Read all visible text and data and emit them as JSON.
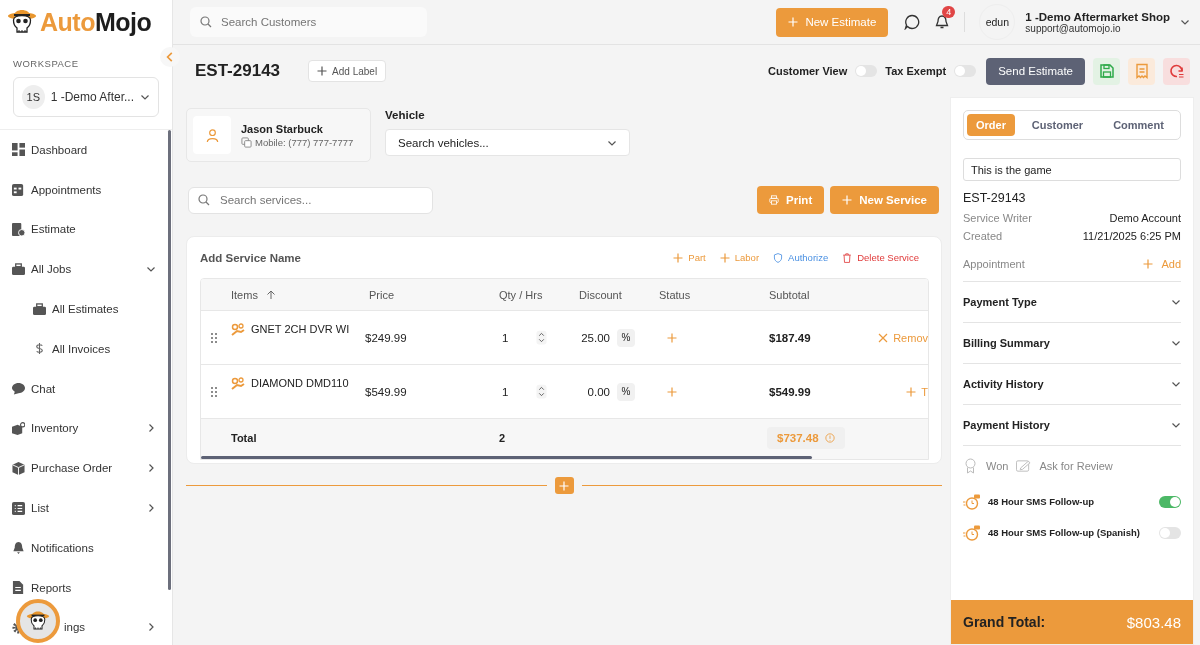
{
  "logo": {
    "lead": "Auto",
    "tail": "Mojo"
  },
  "workspace": {
    "label": "WORKSPACE",
    "initials": "1S",
    "name": "1 -Demo After..."
  },
  "sidebar": {
    "items": [
      {
        "label": "Dashboard",
        "kind": "link"
      },
      {
        "label": "Appointments",
        "kind": "link"
      },
      {
        "label": "Estimate",
        "kind": "link"
      },
      {
        "label": "All Jobs",
        "kind": "group",
        "expanded": true,
        "children": [
          {
            "label": "All Estimates"
          },
          {
            "label": "All Invoices"
          }
        ]
      },
      {
        "label": "Chat",
        "kind": "link"
      },
      {
        "label": "Inventory",
        "kind": "group",
        "expanded": false
      },
      {
        "label": "Purchase Order",
        "kind": "group",
        "expanded": false
      },
      {
        "label": "List",
        "kind": "group",
        "expanded": false
      },
      {
        "label": "Notifications",
        "kind": "link"
      },
      {
        "label": "Reports",
        "kind": "link"
      },
      {
        "label": "ings",
        "kind": "group",
        "expanded": false
      }
    ]
  },
  "topbar": {
    "search_placeholder": "Search Customers",
    "new_estimate": "New Estimate",
    "notification_count": "4",
    "avatar_text": "edun",
    "account_name": "1 -Demo Aftermarket Shop",
    "account_email": "support@automojo.io"
  },
  "estimate": {
    "number": "EST-29143",
    "add_label": "Add Label",
    "switches": [
      {
        "label": "Customer View",
        "on": false
      },
      {
        "label": "Tax Exempt",
        "on": false
      }
    ],
    "send": "Send Estimate"
  },
  "customer": {
    "name": "Jason Starbuck",
    "phone": "Mobile: (777) 777-7777"
  },
  "vehicle": {
    "label": "Vehicle",
    "value": "Search vehicles..."
  },
  "services": {
    "search_placeholder": "Search services...",
    "print": "Print",
    "new_service": "New Service"
  },
  "service": {
    "title": "Add Service Name",
    "actions": [
      {
        "label": "Part",
        "kind": "part"
      },
      {
        "label": "Labor",
        "kind": "labor"
      },
      {
        "label": "Authorize",
        "kind": "authorize"
      },
      {
        "label": "Delete Service",
        "kind": "delete"
      }
    ],
    "columns": [
      "Items",
      "Price",
      "Qty / Hrs",
      "Discount",
      "Status",
      "Subtotal"
    ],
    "rows": [
      {
        "name": "GNET 2CH DVR WI",
        "price": "$249.99",
        "qty": "1",
        "discount": "25.00",
        "discount_unit": "%",
        "subtotal": "$187.49",
        "action": "Remov"
      },
      {
        "name": "DIAMOND DMD110",
        "price": "$549.99",
        "qty": "1",
        "discount": "0.00",
        "discount_unit": "%",
        "subtotal": "$549.99",
        "action": "T"
      }
    ],
    "total": {
      "label": "Total",
      "qty": "2",
      "amount": "$737.48"
    }
  },
  "panel": {
    "tabs": [
      {
        "label": "Order",
        "selected": true
      },
      {
        "label": "Customer",
        "selected": false
      },
      {
        "label": "Comment",
        "selected": false
      }
    ],
    "note": "This is the game",
    "number": "EST-29143",
    "details": [
      {
        "label": "Service Writer",
        "value": "Demo Account"
      },
      {
        "label": "Created",
        "value": "11/21/2025 6:25 PM"
      }
    ],
    "appointment": {
      "label": "Appointment",
      "action": "Add"
    },
    "sections": [
      {
        "title": "Payment Type",
        "expanded": false
      },
      {
        "title": "Billing Summary",
        "expanded": false
      },
      {
        "title": "Activity History",
        "expanded": false
      },
      {
        "title": "Payment History",
        "expanded": false
      }
    ],
    "won": "Won",
    "review": "Ask for Review",
    "followups": [
      {
        "label": "48 Hour SMS Follow-up",
        "on": true
      },
      {
        "label": "48 Hour SMS Follow-up (Spanish)",
        "on": false
      }
    ],
    "grand_total": {
      "label": "Grand Total:",
      "amount": "$803.48"
    }
  }
}
